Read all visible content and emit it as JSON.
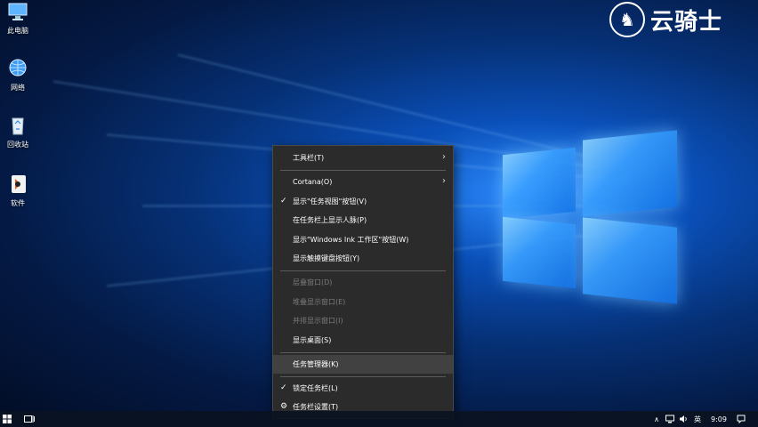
{
  "brand": {
    "name": "云骑士"
  },
  "desktop_icons": [
    {
      "label": "此电脑",
      "icon": "computer-icon"
    },
    {
      "label": "网络",
      "icon": "network-icon"
    },
    {
      "label": "回收站",
      "icon": "recycle-bin-icon"
    },
    {
      "label": "软件",
      "icon": "software-icon"
    }
  ],
  "context_menu": {
    "items": [
      {
        "label": "工具栏(T)",
        "submenu": true
      },
      {
        "label": "Cortana(O)",
        "submenu": true
      },
      {
        "label": "显示\"任务视图\"按钮(V)",
        "checked": true
      },
      {
        "label": "在任务栏上显示人脉(P)"
      },
      {
        "label": "显示\"Windows Ink 工作区\"按钮(W)"
      },
      {
        "label": "显示触摸键盘按钮(Y)"
      },
      {
        "label": "层叠窗口(D)",
        "disabled": true
      },
      {
        "label": "堆叠显示窗口(E)",
        "disabled": true
      },
      {
        "label": "并排显示窗口(I)",
        "disabled": true
      },
      {
        "label": "显示桌面(S)"
      },
      {
        "label": "任务管理器(K)",
        "hovered": true
      },
      {
        "label": "锁定任务栏(L)",
        "checked": true
      },
      {
        "label": "任务栏设置(T)",
        "icon": "gear-icon"
      }
    ],
    "submenu_arrow": "›",
    "check_mark": "✓",
    "settings_glyph": "⚙"
  },
  "taskbar": {
    "start_icon": "windows-start-icon",
    "task_view_icon": "task-view-icon",
    "tray": {
      "up_arrow": "∧",
      "ime_mode": "英",
      "time": "9:09"
    }
  }
}
